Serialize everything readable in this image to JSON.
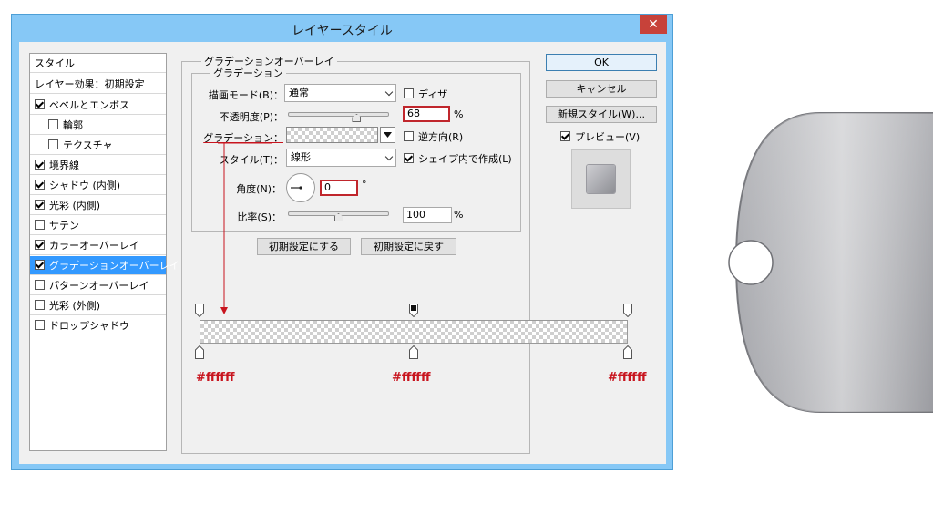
{
  "window": {
    "title": "レイヤースタイル",
    "close_label": "✕"
  },
  "styles": {
    "header": "スタイル",
    "default_item": "レイヤー効果：初期設定",
    "items": [
      {
        "label": "ベベルとエンボス",
        "checked": true
      },
      {
        "label": "輪郭",
        "checked": false
      },
      {
        "label": "テクスチャ",
        "checked": false
      },
      {
        "label": "境界線",
        "checked": true
      },
      {
        "label": "シャドウ (内側)",
        "checked": true
      },
      {
        "label": "光彩 (内側)",
        "checked": true
      },
      {
        "label": "サテン",
        "checked": false
      },
      {
        "label": "カラーオーバーレイ",
        "checked": true
      },
      {
        "label": "グラデーションオーバーレイ",
        "checked": true,
        "selected": true
      },
      {
        "label": "パターンオーバーレイ",
        "checked": false
      },
      {
        "label": "光彩 (外側)",
        "checked": false
      },
      {
        "label": "ドロップシャドウ",
        "checked": false
      }
    ]
  },
  "panel": {
    "outer_title": "グラデーションオーバーレイ",
    "inner_title": "グラデーション",
    "blend_mode": {
      "label": "描画モード(B)：",
      "value": "通常"
    },
    "dither": {
      "label": "ディザ",
      "checked": false
    },
    "opacity": {
      "label": "不透明度(P)：",
      "value": "68",
      "unit": "%",
      "slider": 0.68
    },
    "gradient": {
      "label": "グラデーション："
    },
    "reverse": {
      "label": "逆方向(R)",
      "checked": false
    },
    "style": {
      "label": "スタイル(T)：",
      "value": "線形"
    },
    "align_with_layer": {
      "label": "シェイプ内で作成(L)",
      "checked": true
    },
    "angle": {
      "label": "角度(N)：",
      "value": "0",
      "unit": "°"
    },
    "scale": {
      "label": "比率(S)：",
      "value": "100",
      "unit": "%",
      "slider": 0.5
    },
    "make_default": "初期設定にする",
    "reset_default": "初期設定に戻す"
  },
  "buttons": {
    "ok": "OK",
    "cancel": "キャンセル",
    "new_style": "新規スタイル(W)...",
    "preview": {
      "label": "プレビュー(V)",
      "checked": true
    }
  },
  "gradient_editor": {
    "stops": [
      {
        "color": "#ffffff",
        "label": "#ffffff",
        "position": 0
      },
      {
        "color": "#ffffff",
        "label": "#ffffff",
        "position": 50
      },
      {
        "color": "#ffffff",
        "label": "#ffffff",
        "position": 100
      }
    ],
    "opacity_stops": [
      0,
      50,
      100
    ],
    "annotation_color": "#c8141e"
  },
  "colors": {
    "accent": "#3399ff",
    "title_bar": "#86c8f6",
    "close": "#c7423a",
    "annotation": "#c8141e"
  }
}
